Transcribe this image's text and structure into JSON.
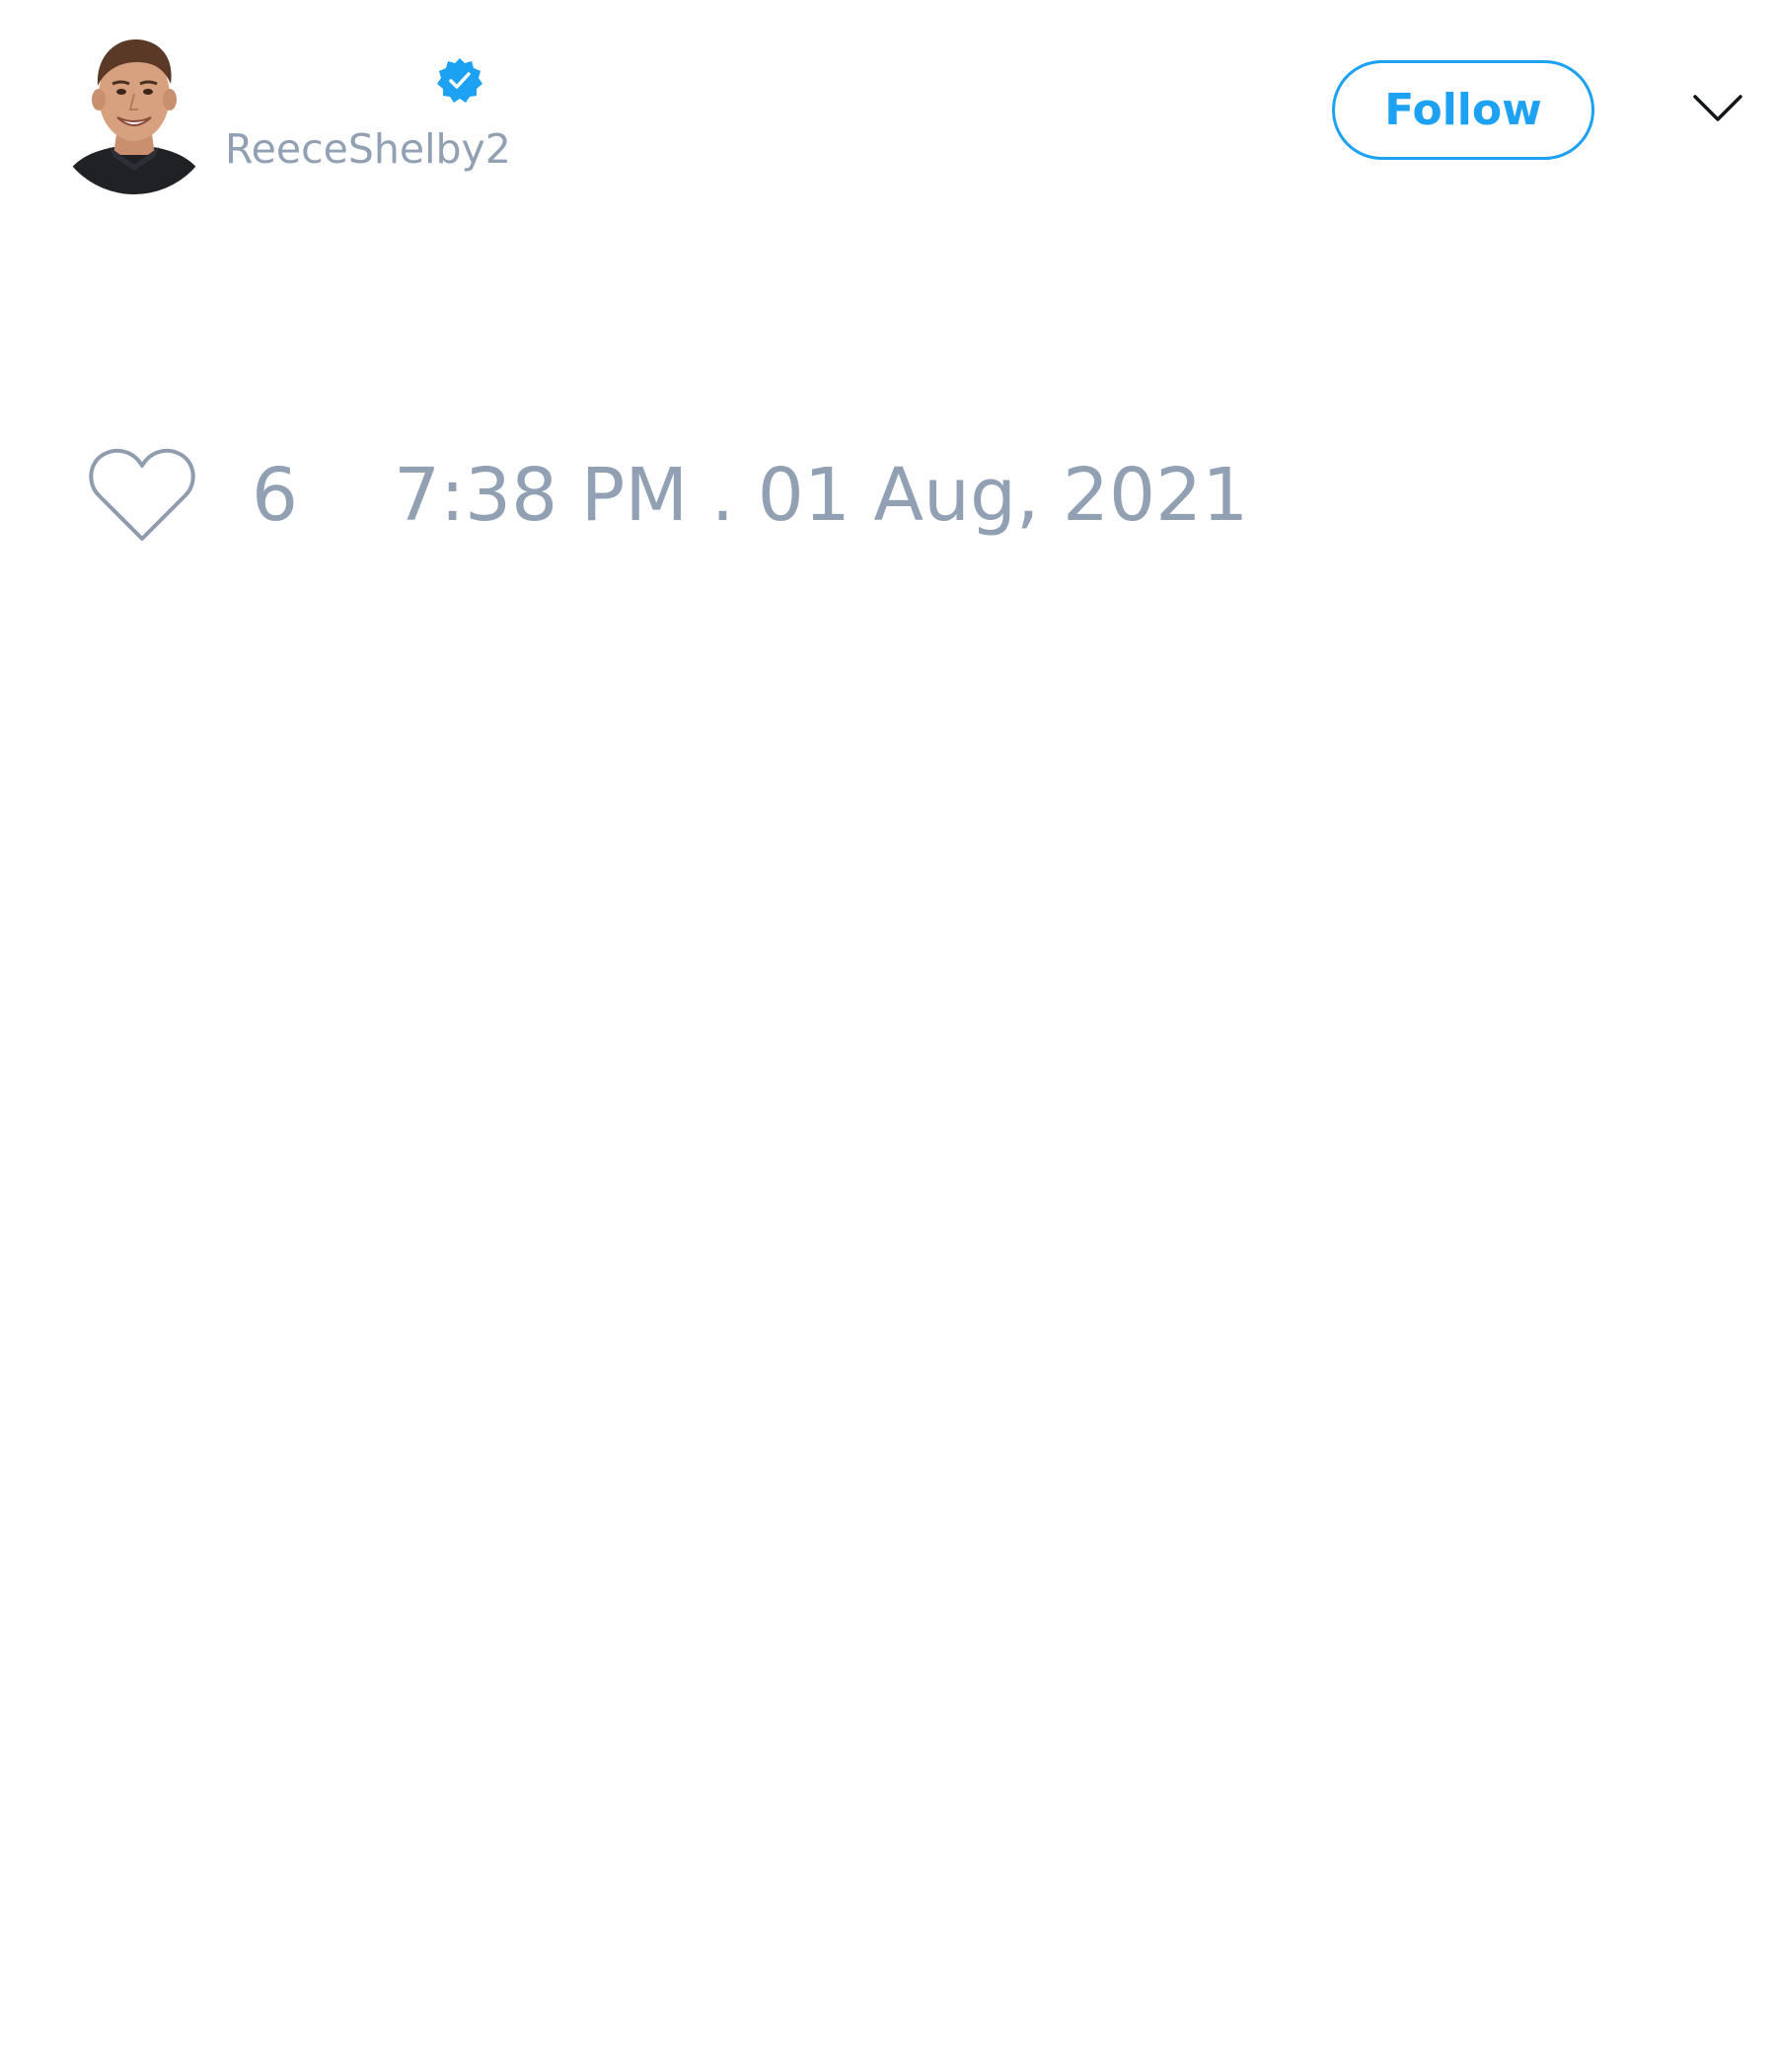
{
  "user": {
    "handle": "ReeceShelby2",
    "verified": true,
    "avatar_icon": "profile-photo",
    "verified_icon": "verified-badge-icon"
  },
  "header": {
    "follow_label": "Follow",
    "more_icon": "chevron-down-icon"
  },
  "tweet": {
    "like_icon": "heart-outline-icon",
    "like_count": "6",
    "timestamp": "7:38 PM . 01 Aug, 2021"
  },
  "colors": {
    "accent": "#1da1f2",
    "muted_text": "#91a0b3",
    "background": "#ffffff"
  }
}
